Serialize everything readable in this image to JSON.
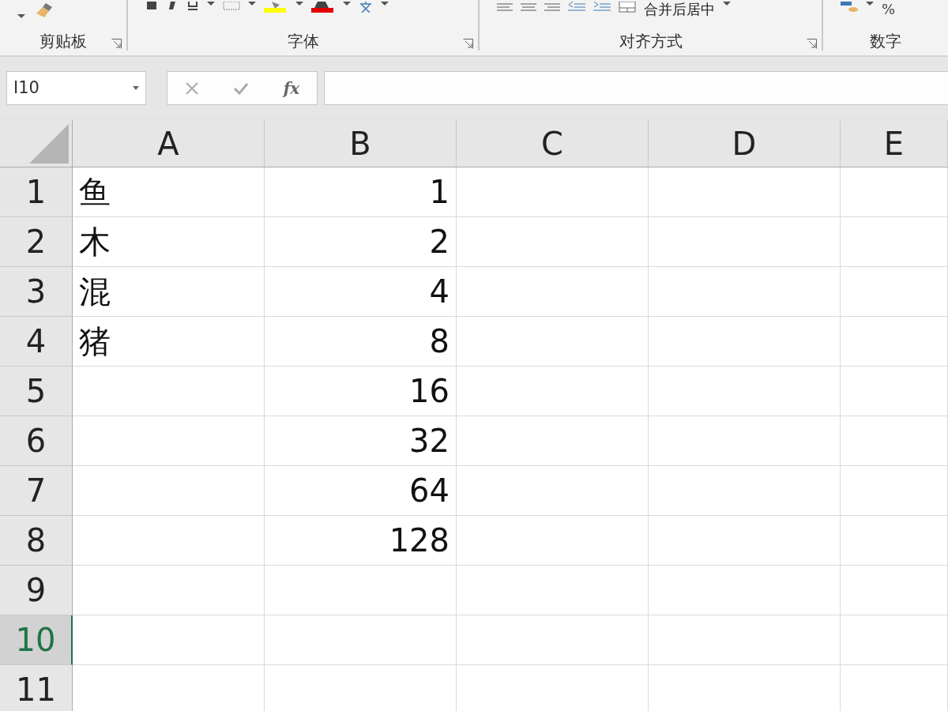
{
  "ribbon": {
    "groups": [
      {
        "label": "剪贴板",
        "launcher": true
      },
      {
        "label": "字体",
        "launcher": true
      },
      {
        "label": "对齐方式",
        "launcher": true
      },
      {
        "label": "数字",
        "launcher": false
      }
    ],
    "merge_button": {
      "label": "合并后居中"
    },
    "percent_button": {
      "label": "%"
    }
  },
  "formula_bar": {
    "name_box": "I10",
    "function_label": "fx"
  },
  "sheet": {
    "columns": [
      {
        "label": "A",
        "selected": false
      },
      {
        "label": "B",
        "selected": false
      },
      {
        "label": "C",
        "selected": false
      },
      {
        "label": "D",
        "selected": false
      },
      {
        "label": "E",
        "selected": false
      }
    ],
    "rows": [
      {
        "header": "1",
        "selected": false,
        "text": "鱼",
        "number": "1"
      },
      {
        "header": "2",
        "selected": false,
        "text": "木",
        "number": "2"
      },
      {
        "header": "3",
        "selected": false,
        "text": "混",
        "number": "4"
      },
      {
        "header": "4",
        "selected": false,
        "text": "猪",
        "number": "8"
      },
      {
        "header": "5",
        "selected": false,
        "number": "16"
      },
      {
        "header": "6",
        "selected": false,
        "number": "32"
      },
      {
        "header": "7",
        "selected": false,
        "number": "64"
      },
      {
        "header": "8",
        "selected": false,
        "number": "128"
      },
      {
        "header": "9",
        "selected": false
      },
      {
        "header": "10",
        "selected": true
      },
      {
        "header": "11",
        "selected": false
      }
    ]
  }
}
